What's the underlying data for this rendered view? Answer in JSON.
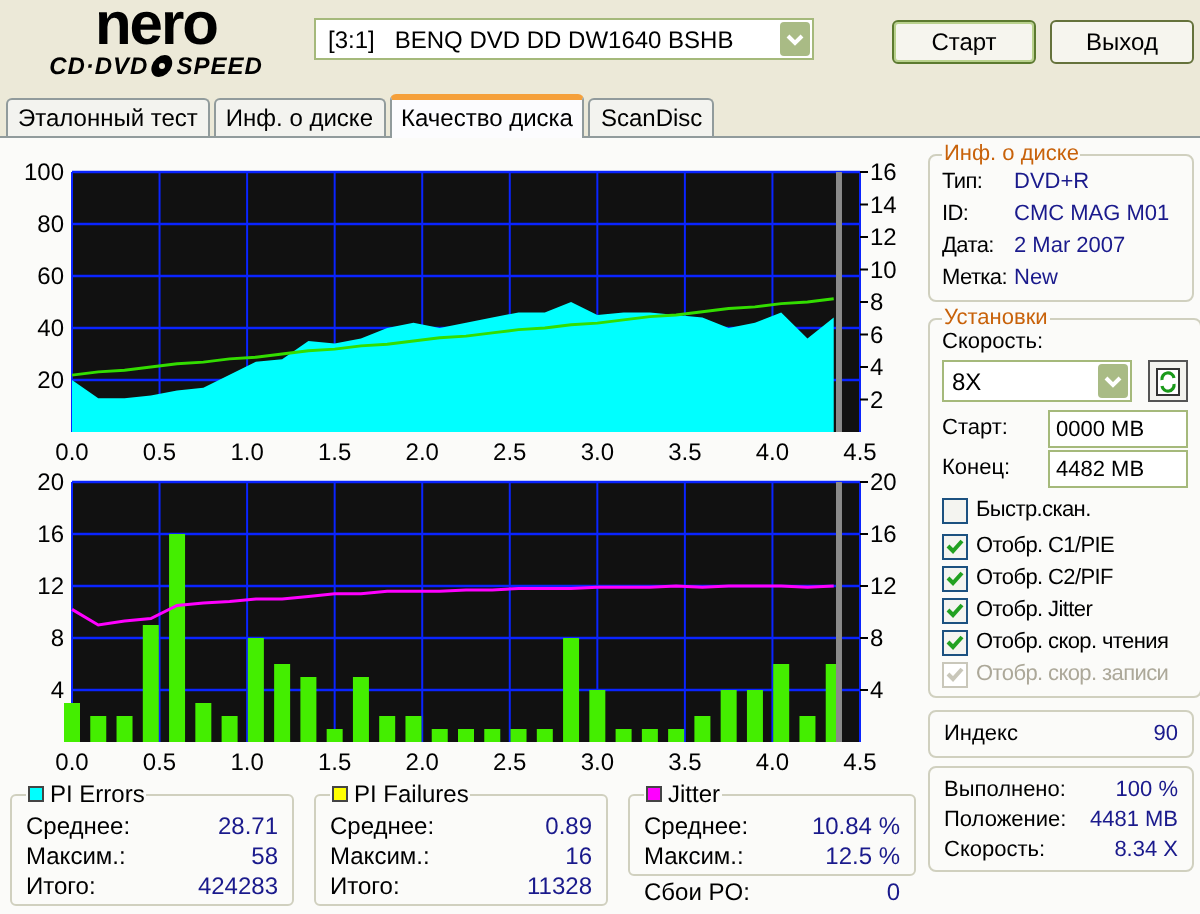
{
  "logo": {
    "brand": "nero",
    "product_left": "CD·DVD",
    "product_right": "SPEED"
  },
  "drive": {
    "value": "[3:1]   BENQ DVD DD DW1640 BSHB"
  },
  "buttons": [
    "Старт",
    "Выход"
  ],
  "tabs": [
    {
      "label": "Эталонный тест",
      "selected": false
    },
    {
      "label": "Инф. о диске",
      "selected": false
    },
    {
      "label": "Качество диска",
      "selected": true
    },
    {
      "label": "ScanDisc",
      "selected": false
    }
  ],
  "charts": [
    {
      "chart_data": {
        "type": "area",
        "x": [
          0,
          0.15,
          0.3,
          0.45,
          0.6,
          0.75,
          0.9,
          1.05,
          1.2,
          1.35,
          1.5,
          1.65,
          1.8,
          1.95,
          2.1,
          2.25,
          2.4,
          2.55,
          2.7,
          2.85,
          3.0,
          3.15,
          3.3,
          3.45,
          3.6,
          3.75,
          3.9,
          4.05,
          4.2,
          4.35
        ],
        "series": [
          {
            "name": "PI Errors",
            "color": "#00ffff",
            "values": [
              20,
              13,
              13,
              14,
              16,
              17,
              22,
              27,
              28,
              35,
              34,
              36,
              40,
              42,
              40,
              42,
              44,
              46,
              46,
              50,
              45,
              46,
              46,
              45,
              44,
              40,
              42,
              46,
              36,
              44
            ]
          },
          {
            "type": "line",
            "axis": "y2",
            "color": "#33dd00",
            "values": [
              3.5,
              3.7,
              3.8,
              4,
              4.2,
              4.3,
              4.5,
              4.6,
              4.8,
              5,
              5.1,
              5.3,
              5.4,
              5.6,
              5.8,
              5.9,
              6.1,
              6.3,
              6.4,
              6.6,
              6.7,
              6.9,
              7.1,
              7.2,
              7.4,
              7.6,
              7.7,
              7.9,
              8,
              8.2
            ]
          }
        ],
        "xlim": [
          0,
          4.5
        ],
        "ylim": [
          0,
          100
        ],
        "y2lim": [
          0,
          16
        ],
        "grid": true,
        "ref_lines": [
          {
            "axis": "x",
            "value": 4.38,
            "color": "#8a8a8a"
          }
        ],
        "xticks": [
          {
            "value": 0,
            "label": "0.0"
          },
          {
            "value": 0.5,
            "label": "0.5"
          },
          {
            "value": 1,
            "label": "1.0"
          },
          {
            "value": 1.5,
            "label": "1.5"
          },
          {
            "value": 2,
            "label": "2.0"
          },
          {
            "value": 2.5,
            "label": "2.5"
          },
          {
            "value": 3,
            "label": "3.0"
          },
          {
            "value": 3.5,
            "label": "3.5"
          },
          {
            "value": 4,
            "label": "4.0"
          },
          {
            "value": 4.5,
            "label": "4.5"
          }
        ],
        "yticks": [
          20,
          40,
          60,
          80,
          100
        ],
        "y2ticks": [
          2,
          4,
          6,
          8,
          10,
          12,
          14,
          16
        ]
      }
    },
    {
      "chart_data": {
        "type": "bar",
        "x": [
          0,
          0.15,
          0.3,
          0.45,
          0.6,
          0.75,
          0.9,
          1.05,
          1.2,
          1.35,
          1.5,
          1.65,
          1.8,
          1.95,
          2.1,
          2.25,
          2.4,
          2.55,
          2.7,
          2.85,
          3.0,
          3.15,
          3.3,
          3.45,
          3.6,
          3.75,
          3.9,
          4.05,
          4.2,
          4.35
        ],
        "series": [
          {
            "name": "PI Failures",
            "color": "#44ee00",
            "values": [
              3,
              2,
              2,
              9,
              16,
              3,
              2,
              8,
              6,
              5,
              1,
              5,
              2,
              2,
              1,
              1,
              1,
              1,
              1,
              8,
              4,
              1,
              1,
              1,
              2,
              4,
              4,
              6,
              2,
              6
            ]
          },
          {
            "name": "Jitter",
            "type": "line",
            "color": "#ff00ff",
            "values": [
              10.2,
              9,
              9.3,
              9.5,
              10.5,
              10.7,
              10.8,
              11,
              11,
              11.2,
              11.4,
              11.4,
              11.6,
              11.6,
              11.6,
              11.7,
              11.7,
              11.8,
              11.8,
              11.8,
              11.9,
              11.9,
              11.9,
              12,
              11.9,
              12,
              12,
              12,
              11.9,
              12
            ]
          }
        ],
        "xlim": [
          0,
          4.5
        ],
        "ylim": [
          0,
          20
        ],
        "y2lim": [
          0,
          20
        ],
        "grid": true,
        "ref_lines": [
          {
            "axis": "x",
            "value": 4.38,
            "color": "#8a8a8a"
          }
        ],
        "xticks": [
          {
            "value": 0,
            "label": "0.0"
          },
          {
            "value": 0.5,
            "label": "0.5"
          },
          {
            "value": 1,
            "label": "1.0"
          },
          {
            "value": 1.5,
            "label": "1.5"
          },
          {
            "value": 2,
            "label": "2.0"
          },
          {
            "value": 2.5,
            "label": "2.5"
          },
          {
            "value": 3,
            "label": "3.0"
          },
          {
            "value": 3.5,
            "label": "3.5"
          },
          {
            "value": 4,
            "label": "4.0"
          },
          {
            "value": 4.5,
            "label": "4.5"
          }
        ],
        "yticks": [
          4,
          8,
          12,
          16,
          20
        ],
        "y2ticks": [
          4,
          8,
          12,
          16,
          20
        ]
      }
    }
  ],
  "stats": [
    {
      "color": "#00ffff",
      "rows": [
        {
          "label": "Среднее:",
          "value": "28.71"
        },
        {
          "label": "Максим.:",
          "value": "58"
        },
        {
          "label": "Итого:",
          "value": "424283"
        }
      ]
    },
    {
      "color": "#ffff00",
      "rows": [
        {
          "label": "Среднее:",
          "value": "0.89"
        },
        {
          "label": "Максим.:",
          "value": "16"
        },
        {
          "label": "Итого:",
          "value": "11328"
        }
      ]
    },
    {
      "color": "#ff00ff",
      "rows": [
        {
          "label": "Среднее:",
          "value": "10.84 %"
        },
        {
          "label": "Максим.:",
          "value": "12.5 %"
        }
      ]
    }
  ],
  "po_failures": {
    "label": "Сбои PO:",
    "value": "0"
  },
  "disc_info": {
    "title": "Инф. о диске",
    "rows": [
      {
        "label": "Тип:",
        "value": "DVD+R"
      },
      {
        "label": "ID:",
        "value": "CMC MAG M01"
      },
      {
        "label": "Дата:",
        "value": "2 Mar 2007"
      },
      {
        "label": "Метка:",
        "value": "New"
      }
    ]
  },
  "settings": {
    "title": "Установки",
    "speed_label": "Скорость:",
    "speed_value": "8X",
    "start_label": "Старт:",
    "start_value": "0000 MB",
    "end_label": "Конец:",
    "end_value": "4482 MB",
    "options": [
      {
        "label": "Быстр.скан.",
        "checked": false,
        "disabled": false
      },
      {
        "label": "Отобр. C1/PIE",
        "checked": true,
        "disabled": false
      },
      {
        "label": "Отобр. C2/PIF",
        "checked": true,
        "disabled": false
      },
      {
        "label": "Отобр. Jitter",
        "checked": true,
        "disabled": false
      },
      {
        "label": "Отобр. скор. чтения",
        "checked": true,
        "disabled": false
      },
      {
        "label": "Отобр. скор. записи",
        "checked": true,
        "disabled": true
      }
    ]
  },
  "index": {
    "label": "Индекс",
    "value": "90"
  },
  "progress": [
    {
      "label": "Выполнено:",
      "value": "100 %"
    },
    {
      "label": "Положение:",
      "value": "4481 MB"
    },
    {
      "label": "Скорость:",
      "value": "8.34 X"
    }
  ]
}
